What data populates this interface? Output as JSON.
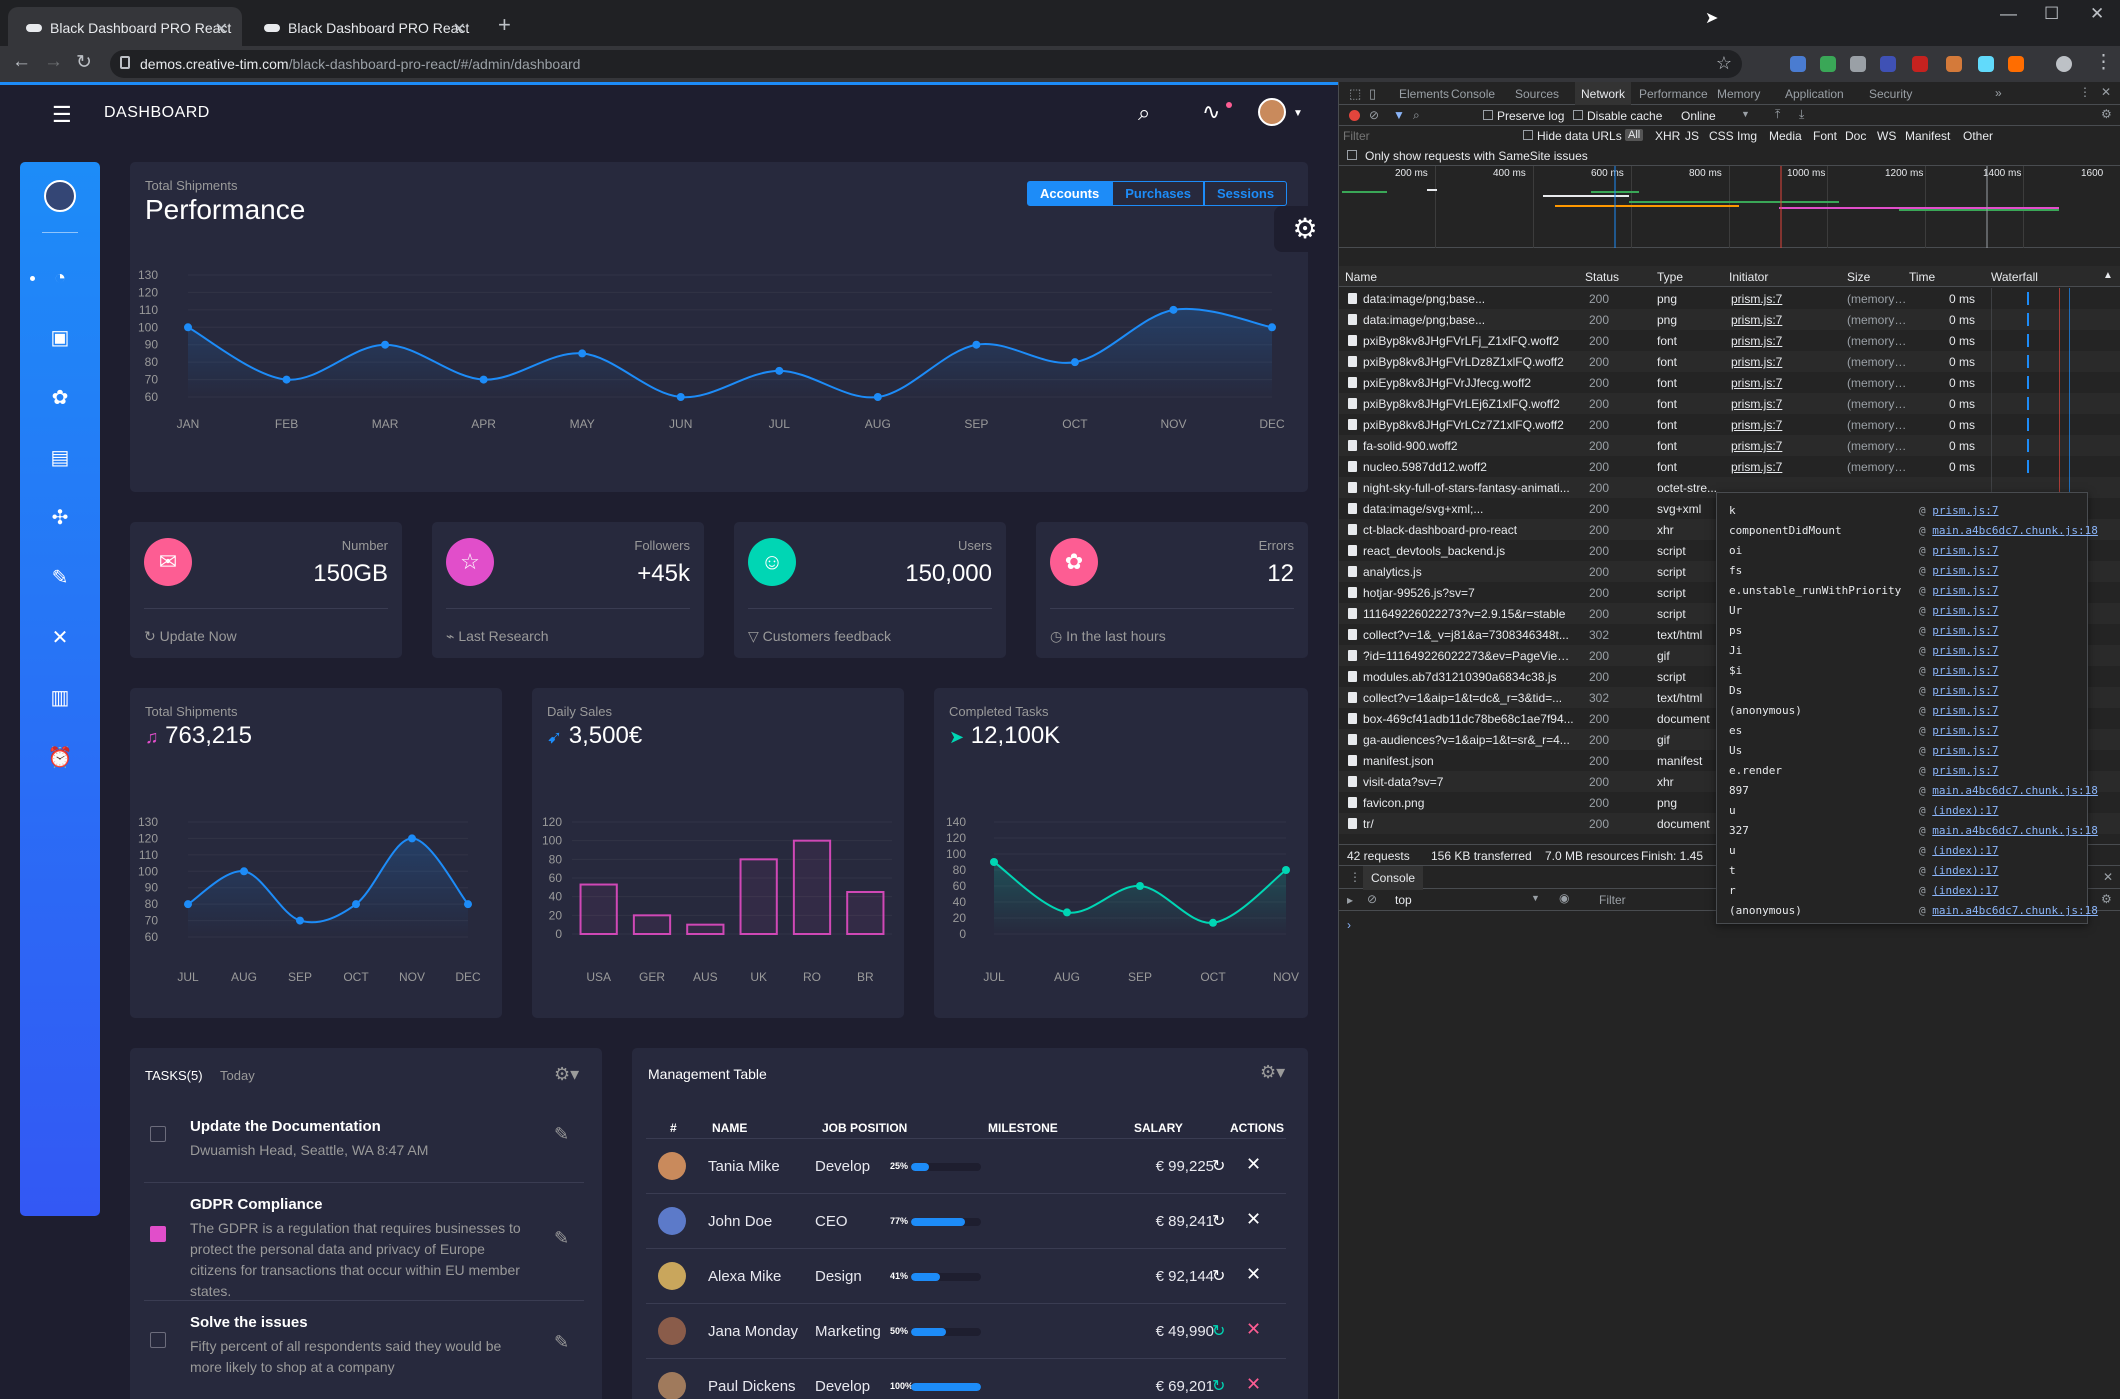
{
  "browser": {
    "tabs": [
      {
        "title": "Black Dashboard PRO React"
      },
      {
        "title": "Black Dashboard PRO React"
      }
    ],
    "url_host": "demos.creative-tim.com",
    "url_path": "/black-dashboard-pro-react/#/admin/dashboard"
  },
  "app": {
    "brand": "DASHBOARD",
    "performance": {
      "category": "Total Shipments",
      "title": "Performance",
      "buttons": [
        "Accounts",
        "Purchases",
        "Sessions"
      ],
      "active_button": "Accounts"
    },
    "stats": [
      {
        "label": "Number",
        "value": "150GB",
        "footer": "Update Now",
        "color": "#fd5d93",
        "icon": "chat-icon"
      },
      {
        "label": "Followers",
        "value": "+45k",
        "footer": "Last Research",
        "color": "#e14eca",
        "icon": "star-icon"
      },
      {
        "label": "Users",
        "value": "150,000",
        "footer": "Customers feedback",
        "color": "#00d6b4",
        "icon": "user-icon"
      },
      {
        "label": "Errors",
        "value": "12",
        "footer": "In the last hours",
        "color": "#fd5d93",
        "icon": "molecule-icon"
      }
    ],
    "small_charts": [
      {
        "category": "Total Shipments",
        "title": "763,215"
      },
      {
        "category": "Daily Sales",
        "title": "3,500€"
      },
      {
        "category": "Completed Tasks",
        "title": "12,100K"
      }
    ],
    "tasks": {
      "title": "TASKS(5)",
      "subtitle": "Today",
      "items": [
        {
          "title": "Update the Documentation",
          "desc": "Dwuamish Head, Seattle, WA 8:47 AM",
          "checked": false
        },
        {
          "title": "GDPR Compliance",
          "desc": "The GDPR is a regulation that requires businesses to protect the personal data and privacy of Europe citizens for transactions that occur within EU member states.",
          "checked": true
        },
        {
          "title": "Solve the issues",
          "desc": "Fifty percent of all respondents said they would be more likely to shop at a company",
          "checked": false
        }
      ]
    },
    "management": {
      "title": "Management Table",
      "headers": [
        "#",
        "NAME",
        "JOB POSITION",
        "MILESTONE",
        "SALARY",
        "ACTIONS"
      ],
      "rows": [
        {
          "name": "Tania Mike",
          "job": "Develop",
          "pct": "25%",
          "progress": 0.25,
          "salary": "€ 99,225"
        },
        {
          "name": "John Doe",
          "job": "CEO",
          "pct": "77%",
          "progress": 0.77,
          "salary": "€ 89,241"
        },
        {
          "name": "Alexa Mike",
          "job": "Design",
          "pct": "41%",
          "progress": 0.41,
          "salary": "€ 92,144"
        },
        {
          "name": "Jana Monday",
          "job": "Marketing",
          "pct": "50%",
          "progress": 0.5,
          "salary": "€ 49,990"
        },
        {
          "name": "Paul Dickens",
          "job": "Develop",
          "pct": "100%",
          "progress": 1.0,
          "salary": "€ 69,201"
        }
      ]
    }
  },
  "chart_data": [
    {
      "type": "line",
      "categories": [
        "JAN",
        "FEB",
        "MAR",
        "APR",
        "MAY",
        "JUN",
        "JUL",
        "AUG",
        "SEP",
        "OCT",
        "NOV",
        "DEC"
      ],
      "values": [
        100,
        70,
        90,
        70,
        85,
        60,
        75,
        60,
        90,
        80,
        110,
        100
      ],
      "ylim": [
        60,
        130
      ],
      "yticks": [
        60,
        70,
        80,
        90,
        100,
        110,
        120,
        130
      ],
      "color": "#1d8cf8"
    },
    {
      "type": "line",
      "categories": [
        "JUL",
        "AUG",
        "SEP",
        "OCT",
        "NOV",
        "DEC"
      ],
      "values": [
        80,
        100,
        70,
        80,
        120,
        80
      ],
      "ylim": [
        60,
        130
      ],
      "yticks": [
        60,
        70,
        80,
        90,
        100,
        110,
        120,
        130
      ],
      "color": "#1d8cf8"
    },
    {
      "type": "bar",
      "categories": [
        "USA",
        "GER",
        "AUS",
        "UK",
        "RO",
        "BR"
      ],
      "values": [
        53,
        20,
        10,
        80,
        100,
        45
      ],
      "ylim": [
        0,
        120
      ],
      "yticks": [
        0,
        20,
        40,
        60,
        80,
        100,
        120
      ],
      "color": "#d048b6"
    },
    {
      "type": "line",
      "categories": [
        "JUL",
        "AUG",
        "SEP",
        "OCT",
        "NOV"
      ],
      "values": [
        90,
        27,
        60,
        14,
        80
      ],
      "ylim": [
        0,
        140
      ],
      "yticks": [
        0,
        20,
        40,
        60,
        80,
        100,
        120,
        140
      ],
      "color": "#00d6b4"
    }
  ],
  "devtools": {
    "tabs": [
      "Elements",
      "Console",
      "Sources",
      "Network",
      "Performance",
      "Memory",
      "Application",
      "Security"
    ],
    "active_tab": "Network",
    "options": [
      "Preserve log",
      "Disable cache"
    ],
    "throttle": "Online",
    "filter_placeholder": "Filter",
    "hide_data_urls": "Hide data URLs",
    "types": [
      "All",
      "XHR",
      "JS",
      "CSS",
      "Img",
      "Media",
      "Font",
      "Doc",
      "WS",
      "Manifest",
      "Other"
    ],
    "samesite": "Only show requests with SameSite issues",
    "timeline_ticks": [
      "200 ms",
      "400 ms",
      "600 ms",
      "800 ms",
      "1000 ms",
      "1200 ms",
      "1400 ms",
      "1600"
    ],
    "columns": [
      "Name",
      "Status",
      "Type",
      "Initiator",
      "Size",
      "Time",
      "Waterfall"
    ],
    "requests": [
      {
        "name": "data:image/png;base...",
        "status": "200",
        "type": "png",
        "init": "prism.js:7",
        "size": "(memory ...",
        "time": "0 ms"
      },
      {
        "name": "data:image/png;base...",
        "status": "200",
        "type": "png",
        "init": "prism.js:7",
        "size": "(memory ...",
        "time": "0 ms"
      },
      {
        "name": "pxiByp8kv8JHgFVrLFj_Z1xlFQ.woff2",
        "status": "200",
        "type": "font",
        "init": "prism.js:7",
        "size": "(memory ...",
        "time": "0 ms"
      },
      {
        "name": "pxiByp8kv8JHgFVrLDz8Z1xlFQ.woff2",
        "status": "200",
        "type": "font",
        "init": "prism.js:7",
        "size": "(memory ...",
        "time": "0 ms"
      },
      {
        "name": "pxiEyp8kv8JHgFVrJJfecg.woff2",
        "status": "200",
        "type": "font",
        "init": "prism.js:7",
        "size": "(memory ...",
        "time": "0 ms"
      },
      {
        "name": "pxiByp8kv8JHgFVrLEj6Z1xlFQ.woff2",
        "status": "200",
        "type": "font",
        "init": "prism.js:7",
        "size": "(memory ...",
        "time": "0 ms"
      },
      {
        "name": "pxiByp8kv8JHgFVrLCz7Z1xlFQ.woff2",
        "status": "200",
        "type": "font",
        "init": "prism.js:7",
        "size": "(memory ...",
        "time": "0 ms"
      },
      {
        "name": "fa-solid-900.woff2",
        "status": "200",
        "type": "font",
        "init": "prism.js:7",
        "size": "(memory ...",
        "time": "0 ms"
      },
      {
        "name": "nucleo.5987dd12.woff2",
        "status": "200",
        "type": "font",
        "init": "prism.js:7",
        "size": "(memory ...",
        "time": "0 ms"
      },
      {
        "name": "night-sky-full-of-stars-fantasy-animati...",
        "status": "200",
        "type": "octet-stre...",
        "init": "",
        "size": "",
        "time": ""
      },
      {
        "name": "data:image/svg+xml;...",
        "status": "200",
        "type": "svg+xml",
        "init": "",
        "size": "",
        "time": ""
      },
      {
        "name": "ct-black-dashboard-pro-react",
        "status": "200",
        "type": "xhr",
        "init": "",
        "size": "",
        "time": ""
      },
      {
        "name": "react_devtools_backend.js",
        "status": "200",
        "type": "script",
        "init": "",
        "size": "",
        "time": ""
      },
      {
        "name": "analytics.js",
        "status": "200",
        "type": "script",
        "init": "",
        "size": "",
        "time": ""
      },
      {
        "name": "hotjar-99526.js?sv=7",
        "status": "200",
        "type": "script",
        "init": "",
        "size": "",
        "time": ""
      },
      {
        "name": "111649226022273?v=2.9.15&r=stable",
        "status": "200",
        "type": "script",
        "init": "",
        "size": "",
        "time": ""
      },
      {
        "name": "collect?v=1&_v=j81&a=7308346348t...",
        "status": "302",
        "type": "text/html",
        "init": "",
        "size": "",
        "time": ""
      },
      {
        "name": "?id=111649226022273&ev=PageView...",
        "status": "200",
        "type": "gif",
        "init": "",
        "size": "",
        "time": ""
      },
      {
        "name": "modules.ab7d31210390a6834c38.js",
        "status": "200",
        "type": "script",
        "init": "",
        "size": "",
        "time": ""
      },
      {
        "name": "collect?v=1&aip=1&t=dc&_r=3&tid=...",
        "status": "302",
        "type": "text/html",
        "init": "",
        "size": "",
        "time": ""
      },
      {
        "name": "box-469cf41adb11dc78be68c1ae7f94...",
        "status": "200",
        "type": "document",
        "init": "",
        "size": "",
        "time": ""
      },
      {
        "name": "ga-audiences?v=1&aip=1&t=sr&_r=4...",
        "status": "200",
        "type": "gif",
        "init": "",
        "size": "",
        "time": ""
      },
      {
        "name": "manifest.json",
        "status": "200",
        "type": "manifest",
        "init": "",
        "size": "",
        "time": ""
      },
      {
        "name": "visit-data?sv=7",
        "status": "200",
        "type": "xhr",
        "init": "",
        "size": "",
        "time": ""
      },
      {
        "name": "favicon.png",
        "status": "200",
        "type": "png",
        "init": "",
        "size": "",
        "time": ""
      },
      {
        "name": "tr/",
        "status": "200",
        "type": "document",
        "init": "",
        "size": "",
        "time": ""
      }
    ],
    "summary": [
      "42 requests",
      "156 KB transferred",
      "7.0 MB resources",
      "Finish: 1.45"
    ],
    "console_tab": "Console",
    "context": "top",
    "console_filter": "Filter",
    "stack": [
      {
        "fn": "k",
        "link": "prism.js:7"
      },
      {
        "fn": "componentDidMount",
        "link": "main.a4bc6dc7.chunk.js:18"
      },
      {
        "fn": "oi",
        "link": "prism.js:7"
      },
      {
        "fn": "fs",
        "link": "prism.js:7"
      },
      {
        "fn": "e.unstable_runWithPriority",
        "link": "prism.js:7"
      },
      {
        "fn": "Ur",
        "link": "prism.js:7"
      },
      {
        "fn": "ps",
        "link": "prism.js:7"
      },
      {
        "fn": "Ji",
        "link": "prism.js:7"
      },
      {
        "fn": "$i",
        "link": "prism.js:7"
      },
      {
        "fn": "Ds",
        "link": "prism.js:7"
      },
      {
        "fn": "(anonymous)",
        "link": "prism.js:7"
      },
      {
        "fn": "es",
        "link": "prism.js:7"
      },
      {
        "fn": "Us",
        "link": "prism.js:7"
      },
      {
        "fn": "e.render",
        "link": "prism.js:7"
      },
      {
        "fn": "897",
        "link": "main.a4bc6dc7.chunk.js:18"
      },
      {
        "fn": "u",
        "link": "(index):17"
      },
      {
        "fn": "327",
        "link": "main.a4bc6dc7.chunk.js:18"
      },
      {
        "fn": "u",
        "link": "(index):17"
      },
      {
        "fn": "t",
        "link": "(index):17"
      },
      {
        "fn": "r",
        "link": "(index):17"
      },
      {
        "fn": "(anonymous)",
        "link": "main.a4bc6dc7.chunk.js:18"
      }
    ]
  }
}
